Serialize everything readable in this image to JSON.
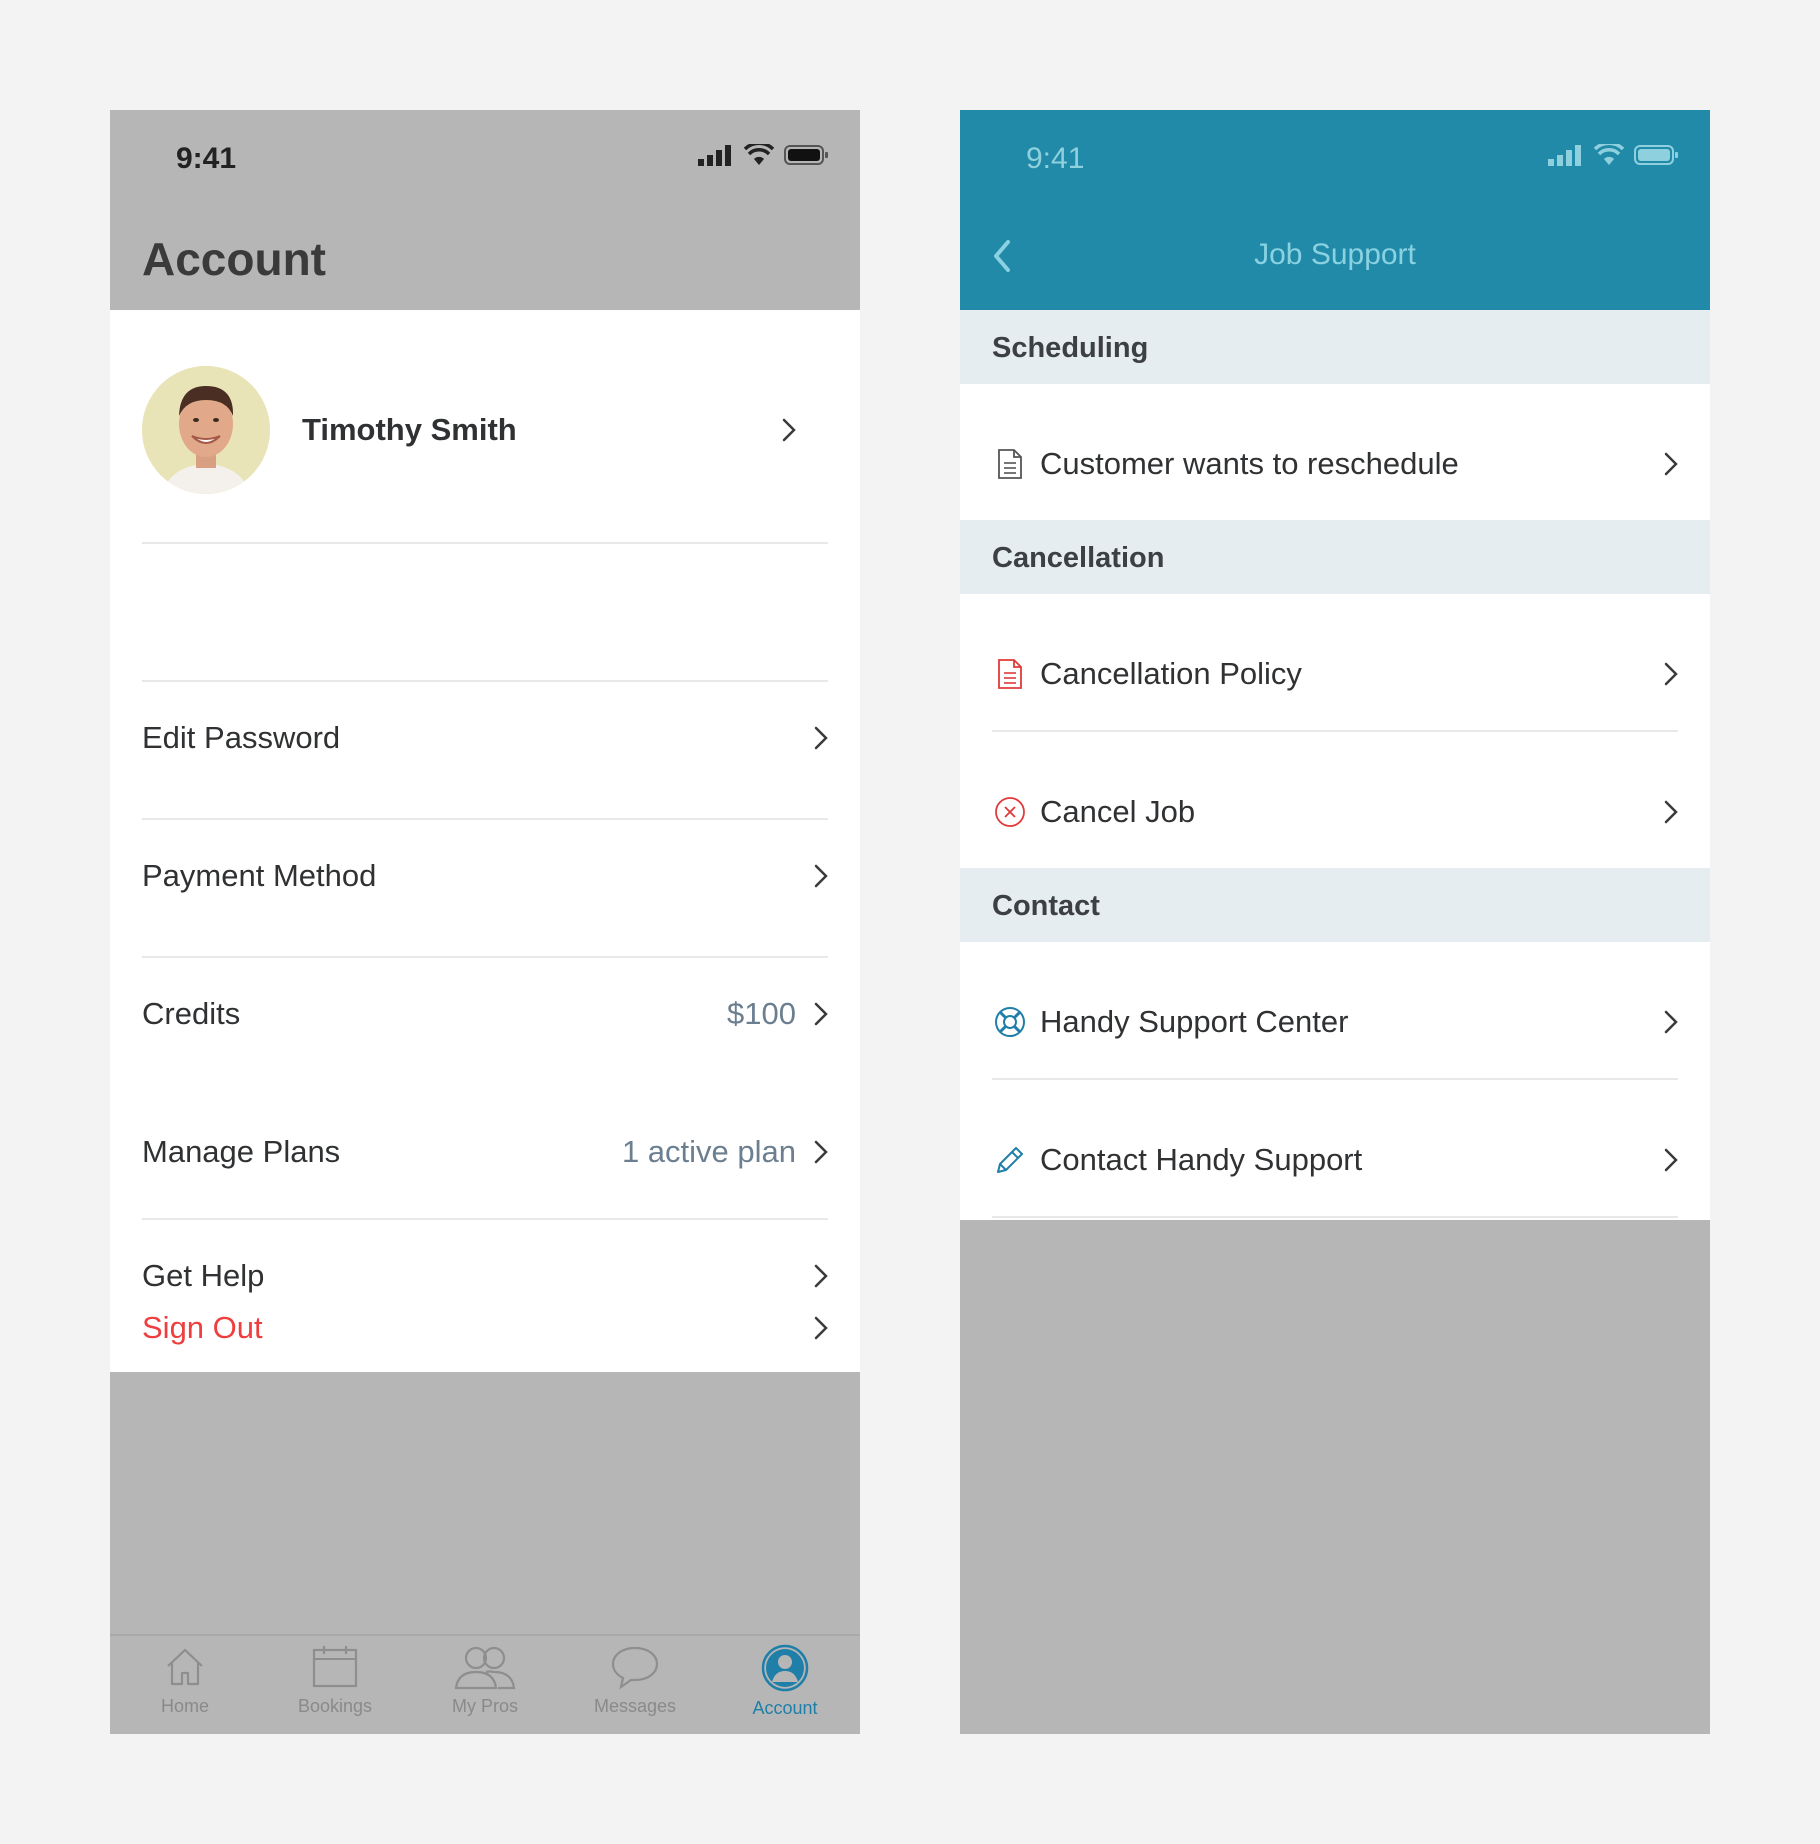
{
  "status_time": "9:41",
  "account": {
    "title": "Account",
    "profile_name": "Timothy Smith",
    "rows": [
      {
        "label": "Edit Password"
      },
      {
        "label": "Payment Method"
      },
      {
        "label": "Credits",
        "value": "$100"
      },
      {
        "label": "Manage Plans",
        "value": "1 active plan"
      },
      {
        "label": "Get Help"
      },
      {
        "label": "Sign Out"
      }
    ],
    "tabs": [
      {
        "label": "Home",
        "icon": "home-icon"
      },
      {
        "label": "Bookings",
        "icon": "calendar-icon"
      },
      {
        "label": "My Pros",
        "icon": "people-icon"
      },
      {
        "label": "Messages",
        "icon": "chat-bubble-icon"
      },
      {
        "label": "Account",
        "icon": "account-icon",
        "active": true
      }
    ]
  },
  "job_support": {
    "title": "Job Support",
    "sections": [
      {
        "header": "Scheduling",
        "items": [
          {
            "label": "Customer wants to reschedule",
            "icon": "document-icon"
          }
        ]
      },
      {
        "header": "Cancellation",
        "items": [
          {
            "label": "Cancellation Policy",
            "icon": "document-red-icon"
          },
          {
            "label": "Cancel Job",
            "icon": "cancel-circle-icon"
          }
        ]
      },
      {
        "header": "Contact",
        "items": [
          {
            "label": "Handy Support Center",
            "icon": "lifebuoy-icon"
          },
          {
            "label": "Contact Handy Support",
            "icon": "pencil-icon"
          }
        ]
      }
    ]
  },
  "colors": {
    "brand_teal": "#218aa8",
    "sign_out_red": "#ee3e3e",
    "section_bg": "#e5edf1",
    "overlay_gray": "#b6b6b6"
  }
}
